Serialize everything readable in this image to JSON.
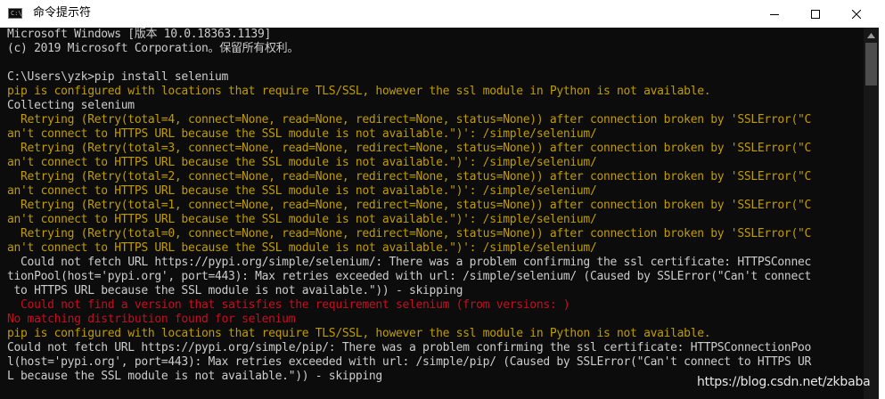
{
  "window": {
    "title": "命令提示符",
    "icon": "cmd-console-icon",
    "icon_glyph": "C:\\"
  },
  "colors": {
    "background": "#0c0c0c",
    "text_default": "#cccccc",
    "text_warning": "#c19c00",
    "text_error": "#c50f1f"
  },
  "console": {
    "lines": [
      {
        "text": "Microsoft Windows [版本 10.0.18363.1139]",
        "color": "gray"
      },
      {
        "text": "(c) 2019 Microsoft Corporation。保留所有权利。",
        "color": "gray"
      },
      {
        "text": "",
        "color": "gray"
      },
      {
        "text": "C:\\Users\\yzk>pip install selenium",
        "color": "gray"
      },
      {
        "text": "pip is configured with locations that require TLS/SSL, however the ssl module in Python is not available.",
        "color": "yellow"
      },
      {
        "text": "Collecting selenium",
        "color": "gray"
      },
      {
        "text": "  Retrying (Retry(total=4, connect=None, read=None, redirect=None, status=None)) after connection broken by 'SSLError(\"C",
        "color": "yellow"
      },
      {
        "text": "an't connect to HTTPS URL because the SSL module is not available.\")': /simple/selenium/",
        "color": "yellow"
      },
      {
        "text": "  Retrying (Retry(total=3, connect=None, read=None, redirect=None, status=None)) after connection broken by 'SSLError(\"C",
        "color": "yellow"
      },
      {
        "text": "an't connect to HTTPS URL because the SSL module is not available.\")': /simple/selenium/",
        "color": "yellow"
      },
      {
        "text": "  Retrying (Retry(total=2, connect=None, read=None, redirect=None, status=None)) after connection broken by 'SSLError(\"C",
        "color": "yellow"
      },
      {
        "text": "an't connect to HTTPS URL because the SSL module is not available.\")': /simple/selenium/",
        "color": "yellow"
      },
      {
        "text": "  Retrying (Retry(total=1, connect=None, read=None, redirect=None, status=None)) after connection broken by 'SSLError(\"C",
        "color": "yellow"
      },
      {
        "text": "an't connect to HTTPS URL because the SSL module is not available.\")': /simple/selenium/",
        "color": "yellow"
      },
      {
        "text": "  Retrying (Retry(total=0, connect=None, read=None, redirect=None, status=None)) after connection broken by 'SSLError(\"C",
        "color": "yellow"
      },
      {
        "text": "an't connect to HTTPS URL because the SSL module is not available.\")': /simple/selenium/",
        "color": "yellow"
      },
      {
        "text": "  Could not fetch URL https://pypi.org/simple/selenium/: There was a problem confirming the ssl certificate: HTTPSConnec",
        "color": "gray"
      },
      {
        "text": "tionPool(host='pypi.org', port=443): Max retries exceeded with url: /simple/selenium/ (Caused by SSLError(\"Can't connect",
        "color": "gray"
      },
      {
        "text": " to HTTPS URL because the SSL module is not available.\")) - skipping",
        "color": "gray"
      },
      {
        "text": "  Could not find a version that satisfies the requirement selenium (from versions: )",
        "color": "red"
      },
      {
        "text": "No matching distribution found for selenium",
        "color": "red"
      },
      {
        "text": "pip is configured with locations that require TLS/SSL, however the ssl module in Python is not available.",
        "color": "yellow"
      },
      {
        "text": "Could not fetch URL https://pypi.org/simple/pip/: There was a problem confirming the ssl certificate: HTTPSConnectionPoo",
        "color": "gray"
      },
      {
        "text": "l(host='pypi.org', port=443): Max retries exceeded with url: /simple/pip/ (Caused by SSLError(\"Can't connect to HTTPS UR",
        "color": "gray"
      },
      {
        "text": "L because the SSL module is not available.\")) - skipping",
        "color": "gray"
      }
    ]
  },
  "watermark": "https://blog.csdn.net/zkbaba"
}
